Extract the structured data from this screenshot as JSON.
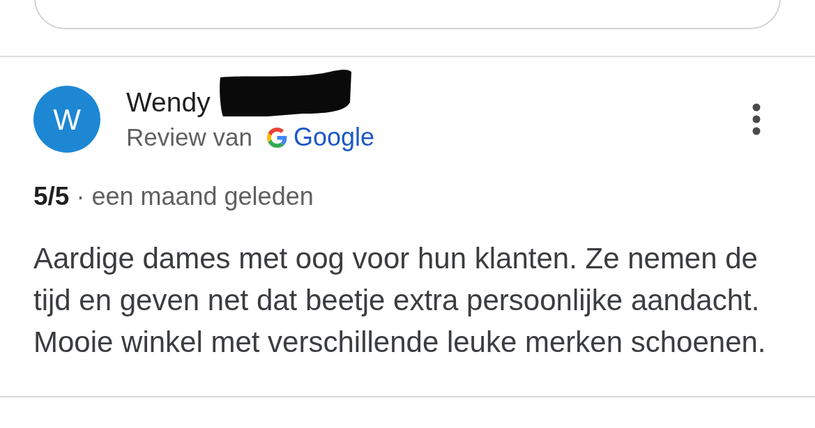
{
  "review": {
    "avatar_initial": "W",
    "author": "Wendy",
    "name_redacted": true,
    "source_label": "Review van",
    "source": "Google",
    "rating": "5/5",
    "time": "· een maand geleden",
    "text": "Aardige dames met oog voor hun klanten. Ze nemen de tijd en geven net dat beetje extra persoonlijke aandacht. Mooie winkel met verschillende leuke merken schoenen."
  }
}
